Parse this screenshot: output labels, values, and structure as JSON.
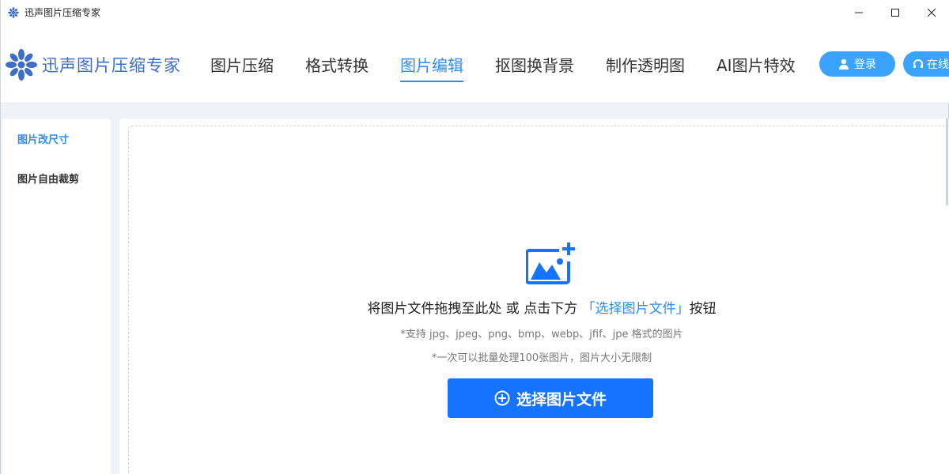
{
  "window": {
    "title": "迅声图片压缩专家",
    "controls": [
      "minimize-icon",
      "maximize-icon",
      "close-icon"
    ]
  },
  "header": {
    "logo_text": "迅声图片压缩专家",
    "nav": [
      {
        "label": "图片压缩",
        "active": false
      },
      {
        "label": "格式转换",
        "active": false
      },
      {
        "label": "图片编辑",
        "active": true
      },
      {
        "label": "抠图换背景",
        "active": false
      },
      {
        "label": "制作透明图",
        "active": false
      },
      {
        "label": "AI图片特效",
        "active": false
      }
    ],
    "login_label": "登录",
    "service_label": "在线"
  },
  "sidebar": {
    "items": [
      {
        "label": "图片改尺寸",
        "active": true
      },
      {
        "label": "图片自由裁剪",
        "active": false
      }
    ]
  },
  "main": {
    "drop_text_before": "将图片文件拖拽至此处 或 点击下方 ",
    "drop_text_link": "「选择图片文件」",
    "drop_text_after": "按钮",
    "hint_formats": "*支持 jpg、jpeg、png、bmp、webp、jfif、jpe 格式的图片",
    "hint_batch": "*一次可以批量处理100张图片，图片大小无限制",
    "select_button_label": "选择图片文件"
  },
  "colors": {
    "accent": "#2e8cf0",
    "button_primary": "#1673ff",
    "pill": "#3aa2ff",
    "logo": "#3d6ec8"
  }
}
